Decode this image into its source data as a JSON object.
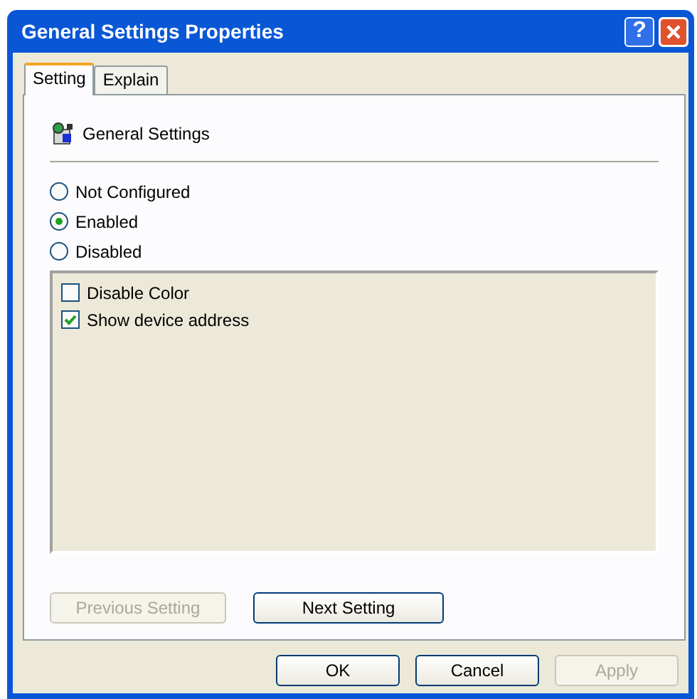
{
  "window": {
    "title": "General Settings Properties",
    "help_button": "?"
  },
  "tabs": [
    {
      "label": "Setting",
      "selected": true
    },
    {
      "label": "Explain",
      "selected": false
    }
  ],
  "policy": {
    "name": "General Settings"
  },
  "states": [
    {
      "label": "Not Configured",
      "selected": false
    },
    {
      "label": "Enabled",
      "selected": true
    },
    {
      "label": "Disabled",
      "selected": false
    }
  ],
  "options": [
    {
      "label": "Disable Color",
      "checked": false
    },
    {
      "label": "Show device address",
      "checked": true
    }
  ],
  "nav_buttons": [
    {
      "label": "Previous Setting",
      "disabled": true
    },
    {
      "label": "Next Setting",
      "disabled": false
    }
  ],
  "buttons": [
    {
      "label": "OK",
      "disabled": false
    },
    {
      "label": "Cancel",
      "disabled": false
    },
    {
      "label": "Apply",
      "disabled": true
    }
  ]
}
